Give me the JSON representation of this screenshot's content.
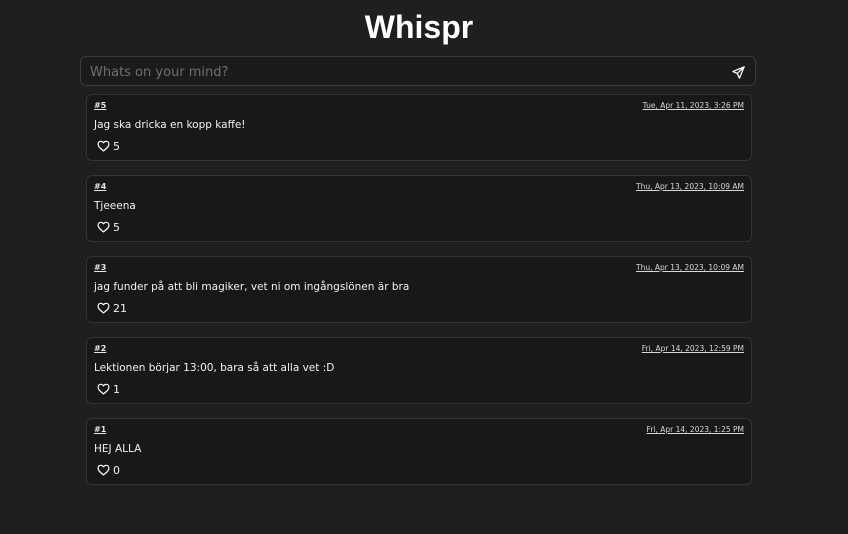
{
  "header": {
    "title": "Whispr"
  },
  "composer": {
    "placeholder": "Whats on your mind?"
  },
  "icons": {
    "send": "paper-plane-icon",
    "like": "heart-outline-icon"
  },
  "colors": {
    "background": "#1f1f1f",
    "card": "#181818",
    "border": "#343434",
    "text": "#ffffff"
  },
  "posts": [
    {
      "id": "#5",
      "date": "Tue, Apr 11, 2023, 3:26 PM",
      "text": "Jag ska dricka en kopp kaffe!",
      "likes": "5"
    },
    {
      "id": "#4",
      "date": "Thu, Apr 13, 2023, 10:09 AM",
      "text": "Tjeeena",
      "likes": "5"
    },
    {
      "id": "#3",
      "date": "Thu, Apr 13, 2023, 10:09 AM",
      "text": "jag funder på att bli magiker, vet ni om ingångslönen är bra",
      "likes": "21"
    },
    {
      "id": "#2",
      "date": "Fri, Apr 14, 2023, 12:59 PM",
      "text": "Lektionen börjar 13:00, bara så att alla vet :D",
      "likes": "1"
    },
    {
      "id": "#1",
      "date": "Fri, Apr 14, 2023, 1:25 PM",
      "text": "HEJ ALLA",
      "likes": "0"
    }
  ]
}
